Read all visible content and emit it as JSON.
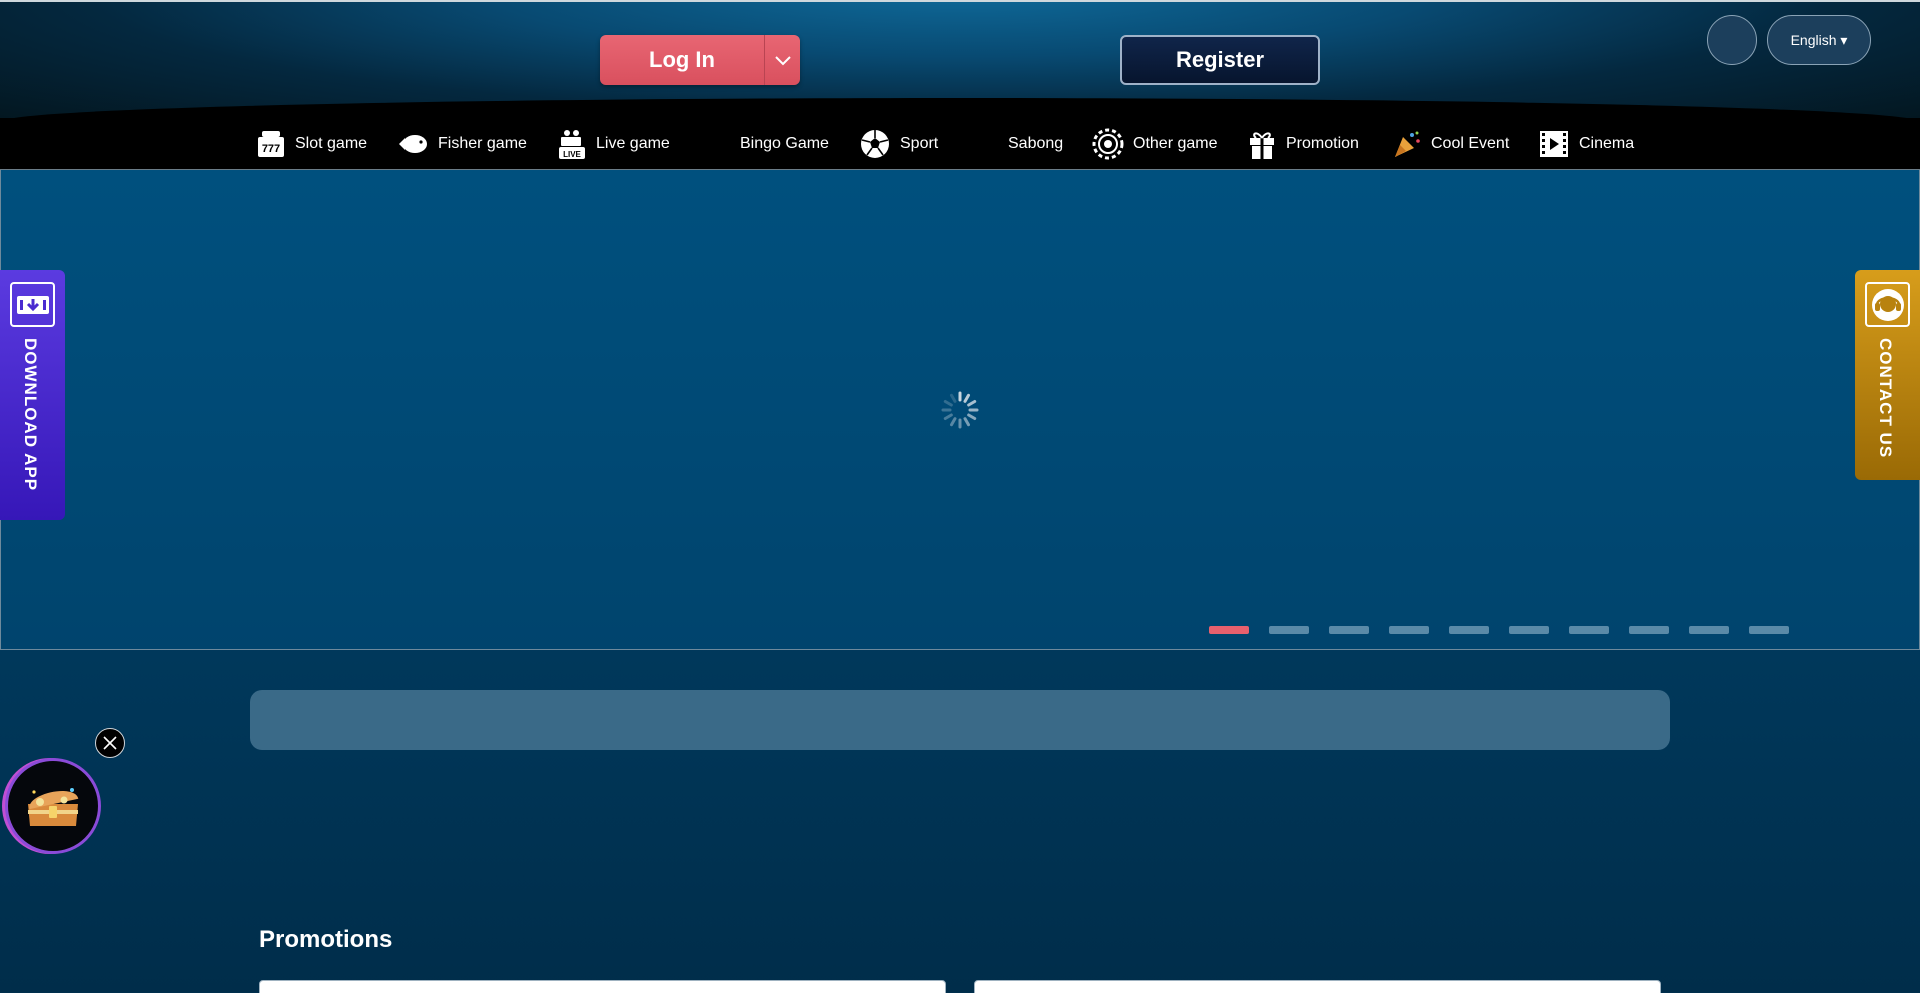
{
  "header": {
    "login_label": "Log In",
    "register_label": "Register",
    "language_label": "English ▾"
  },
  "nav": {
    "items": [
      {
        "label": "Slot game",
        "icon": "slot-777-icon"
      },
      {
        "label": "Fisher game",
        "icon": "fish-icon"
      },
      {
        "label": "Live game",
        "icon": "live-camera-icon"
      },
      {
        "label": "Bingo Game",
        "icon": "bingo-icon"
      },
      {
        "label": "Sport",
        "icon": "soccer-ball-icon"
      },
      {
        "label": "Sabong",
        "icon": "rooster-icon"
      },
      {
        "label": "Other game",
        "icon": "casino-chip-icon"
      },
      {
        "label": "Promotion",
        "icon": "gift-icon"
      },
      {
        "label": "Cool Event",
        "icon": "party-popper-icon"
      },
      {
        "label": "Cinema",
        "icon": "film-icon"
      }
    ]
  },
  "banner": {
    "loading": true,
    "slide_count": 10,
    "active_slide": 1
  },
  "side": {
    "download_label": "DOWNLOAD APP",
    "contact_label": "CONTACT US"
  },
  "promotions": {
    "title": "Promotions"
  },
  "colors": {
    "accent": "#e8606d",
    "register_bg": "#0b1c3b",
    "download_bg": "#4a2bd0",
    "contact_bg": "#c48c10",
    "page_bg": "#004a77"
  }
}
